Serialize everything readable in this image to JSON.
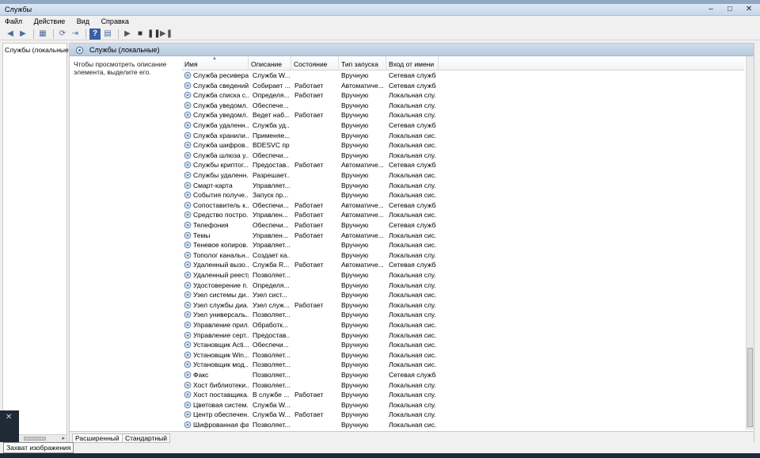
{
  "window": {
    "title": "Службы",
    "controls": [
      "‒",
      "□",
      "✕"
    ]
  },
  "menu": [
    "Файл",
    "Действие",
    "Вид",
    "Справка"
  ],
  "toolbar_icons": [
    "back-arrow-icon",
    "forward-arrow-icon",
    "show-tree-icon",
    "refresh-icon",
    "export-list-icon",
    "help-icon",
    "properties-icon",
    "start-service-icon",
    "stop-service-icon",
    "pause-service-icon",
    "restart-service-icon"
  ],
  "tree": {
    "root": "Службы (локальные)"
  },
  "panel": {
    "header": "Службы (локальные)",
    "description": "Чтобы просмотреть описание элемента, выделите его."
  },
  "columns": [
    "Имя",
    "Описание",
    "Состояние",
    "Тип запуска",
    "Вход от имени"
  ],
  "services": [
    [
      "Служба ресивера...",
      "Служба W...",
      "",
      "Вручную",
      "Сетевая служба"
    ],
    [
      "Служба сведений...",
      "Собирает ...",
      "Работает",
      "Автоматиче...",
      "Сетевая служба"
    ],
    [
      "Служба списка с...",
      "Определя...",
      "Работает",
      "Вручную",
      "Локальная слу..."
    ],
    [
      "Служба уведомл...",
      "Обеспече...",
      "",
      "Вручную",
      "Локальная слу..."
    ],
    [
      "Служба уведомл...",
      "Ведет наб...",
      "Работает",
      "Вручную",
      "Локальная слу..."
    ],
    [
      "Служба удаленн...",
      "Служба уд...",
      "",
      "Вручную",
      "Сетевая служба"
    ],
    [
      "Служба хранили...",
      "Применяе...",
      "",
      "Вручную",
      "Локальная сис..."
    ],
    [
      "Служба шифров...",
      "BDESVC пр...",
      "",
      "Вручную",
      "Локальная сис..."
    ],
    [
      "Служба шлюза у...",
      "Обеспечи...",
      "",
      "Вручную",
      "Локальная слу..."
    ],
    [
      "Службы криптог...",
      "Предостав...",
      "Работает",
      "Автоматиче...",
      "Сетевая служба"
    ],
    [
      "Службы удаленн...",
      "Разрешает...",
      "",
      "Вручную",
      "Локальная сис..."
    ],
    [
      "Смарт-карта",
      "Управляет...",
      "",
      "Вручную",
      "Локальная слу..."
    ],
    [
      "События получе...",
      "Запуск пр...",
      "",
      "Вручную",
      "Локальная сис..."
    ],
    [
      "Сопоставитель к...",
      "Обеспечи...",
      "Работает",
      "Автоматиче...",
      "Сетевая служба"
    ],
    [
      "Средство постро...",
      "Управлен...",
      "Работает",
      "Автоматиче...",
      "Локальная сис..."
    ],
    [
      "Телефония",
      "Обеспечи...",
      "Работает",
      "Вручную",
      "Сетевая служба"
    ],
    [
      "Темы",
      "Управлен...",
      "Работает",
      "Автоматиче...",
      "Локальная сис..."
    ],
    [
      "Теневое копиров...",
      "Управляет...",
      "",
      "Вручную",
      "Локальная сис..."
    ],
    [
      "Тополог канальн...",
      "Создает ка...",
      "",
      "Вручную",
      "Локальная слу..."
    ],
    [
      "Удаленный вызо...",
      "Служба R...",
      "Работает",
      "Автоматиче...",
      "Сетевая служба"
    ],
    [
      "Удаленный реестр",
      "Позволяет...",
      "",
      "Вручную",
      "Локальная слу..."
    ],
    [
      "Удостоверение п...",
      "Определя...",
      "",
      "Вручную",
      "Локальная слу..."
    ],
    [
      "Узел системы ди...",
      "Узел сист...",
      "",
      "Вручную",
      "Локальная сис..."
    ],
    [
      "Узел службы диа...",
      "Узел служ...",
      "Работает",
      "Вручную",
      "Локальная слу..."
    ],
    [
      "Узел универсаль...",
      "Позволяет...",
      "",
      "Вручную",
      "Локальная слу..."
    ],
    [
      "Управление прил...",
      "Обработк...",
      "",
      "Вручную",
      "Локальная сис..."
    ],
    [
      "Управление серт...",
      "Предостав...",
      "",
      "Вручную",
      "Локальная сис..."
    ],
    [
      "Установщик Acti...",
      "Обеспечи...",
      "",
      "Вручную",
      "Локальная сис..."
    ],
    [
      "Установщик Win...",
      "Позволяет...",
      "",
      "Вручную",
      "Локальная сис..."
    ],
    [
      "Установщик мод...",
      "Позволяет...",
      "",
      "Вручную",
      "Локальная сис..."
    ],
    [
      "Факс",
      "Позволяет...",
      "",
      "Вручную",
      "Сетевая служба"
    ],
    [
      "Хост библиотеки...",
      "Позволяет...",
      "",
      "Вручную",
      "Локальная слу..."
    ],
    [
      "Хост поставщика...",
      "В службе ...",
      "Работает",
      "Вручную",
      "Локальная слу..."
    ],
    [
      "Цветовая систем...",
      "Служба W...",
      "",
      "Вручную",
      "Локальная слу..."
    ],
    [
      "Центр обеспечен...",
      "Служба W...",
      "Работает",
      "Вручную",
      "Локальная слу..."
    ],
    [
      "Шифрованная фа...",
      "Позволяет...",
      "",
      "Вручную",
      "Локальная сис..."
    ]
  ],
  "tabs": [
    "Расширенный",
    "Стандартный"
  ],
  "capture_label": "Захват изображения",
  "colors": {
    "accent": "#b8cbe0",
    "window_bg": "#f0f0f0",
    "taskbar": "#1e2b3a"
  }
}
